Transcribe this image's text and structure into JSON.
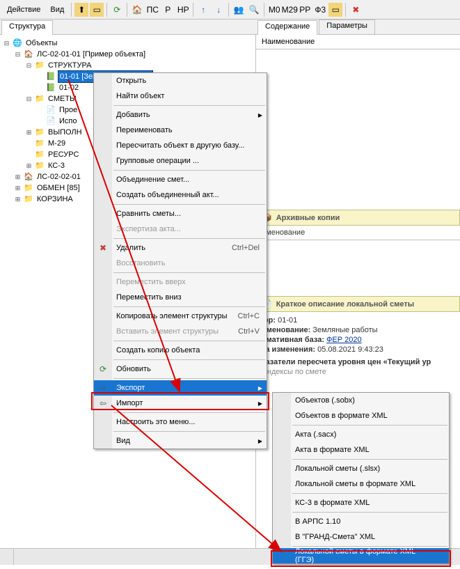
{
  "toolbar": {
    "action": "Действие",
    "view": "Вид"
  },
  "left_tab": "Структура",
  "right_tabs": {
    "content": "Содержание",
    "params": "Параметры"
  },
  "right_header": "Наименование",
  "tree": {
    "root": "Объекты",
    "items": [
      {
        "indent": 2,
        "exp": "⊟",
        "icon": "🏠",
        "cls": "house",
        "label": "ЛС-02-01-01 [Пример объекта]"
      },
      {
        "indent": 3,
        "exp": "⊟",
        "icon": "📁",
        "cls": "folder",
        "label": "СТРУКТУРА"
      },
      {
        "indent": 4,
        "exp": "",
        "icon": "📗",
        "cls": "folder",
        "label": "01-01 [Земляные работы]",
        "selected": true
      },
      {
        "indent": 4,
        "exp": "",
        "icon": "📗",
        "cls": "folder",
        "label": "01-02"
      },
      {
        "indent": 3,
        "exp": "⊟",
        "icon": "📁",
        "cls": "folder",
        "label": "СМЕТЫ"
      },
      {
        "indent": 4,
        "exp": "",
        "icon": "📄",
        "cls": "",
        "label": "Прое"
      },
      {
        "indent": 4,
        "exp": "",
        "icon": "📄",
        "cls": "",
        "label": "Испо"
      },
      {
        "indent": 3,
        "exp": "⊞",
        "icon": "📁",
        "cls": "folder",
        "label": "ВЫПОЛН"
      },
      {
        "indent": 3,
        "exp": "",
        "icon": "📁",
        "cls": "folder",
        "label": "М-29"
      },
      {
        "indent": 3,
        "exp": "",
        "icon": "📁",
        "cls": "folder",
        "label": "РЕСУРС"
      },
      {
        "indent": 3,
        "exp": "⊞",
        "icon": "📁",
        "cls": "folder",
        "label": "КС-3"
      },
      {
        "indent": 2,
        "exp": "⊞",
        "icon": "🏠",
        "cls": "house",
        "label": "ЛС-02-02-01"
      },
      {
        "indent": 2,
        "exp": "⊞",
        "icon": "📁",
        "cls": "folder-y",
        "label": "ОБМЕН  [85]"
      },
      {
        "indent": 2,
        "exp": "⊞",
        "icon": "📁",
        "cls": "folder-y",
        "label": "КОРЗИНА"
      }
    ]
  },
  "ctx": {
    "items": [
      {
        "label": "Открыть"
      },
      {
        "label": "Найти объект"
      },
      {
        "sep": true
      },
      {
        "label": "Добавить",
        "arrow": true
      },
      {
        "label": "Переименовать"
      },
      {
        "label": "Пересчитать объект в другую базу..."
      },
      {
        "label": "Групповые операции ..."
      },
      {
        "sep": true
      },
      {
        "label": "Объединение смет..."
      },
      {
        "label": "Создать объединенный акт..."
      },
      {
        "sep": true
      },
      {
        "label": "Сравнить сметы..."
      },
      {
        "label": "Экспертиза акта...",
        "disabled": true
      },
      {
        "sep": true
      },
      {
        "label": "Удалить",
        "shortcut": "Ctrl+Del",
        "icon": "✖",
        "iconcolor": "#c04040"
      },
      {
        "label": "Восстановить",
        "disabled": true
      },
      {
        "sep": true
      },
      {
        "label": "Переместить вверх",
        "disabled": true
      },
      {
        "label": "Переместить вниз"
      },
      {
        "sep": true
      },
      {
        "label": "Копировать элемент структуры",
        "shortcut": "Ctrl+C"
      },
      {
        "label": "Вставить элемент структуры",
        "shortcut": "Ctrl+V",
        "disabled": true
      },
      {
        "sep": true
      },
      {
        "label": "Создать копию объекта"
      },
      {
        "sep": true
      },
      {
        "label": "Обновить",
        "icon": "⟳",
        "iconcolor": "#2a8a2a"
      },
      {
        "sep": true
      },
      {
        "label": "Экспорт",
        "arrow": true,
        "selected": true,
        "icon": "⇨"
      },
      {
        "label": "Импорт",
        "arrow": true,
        "icon": "⇦"
      },
      {
        "sep": true
      },
      {
        "label": "Настроить это меню..."
      },
      {
        "sep": true
      },
      {
        "label": "Вид",
        "arrow": true
      }
    ]
  },
  "submenu": {
    "items": [
      {
        "label": "Объектов (.sobx)"
      },
      {
        "label": "Объектов в формате XML"
      },
      {
        "sep": true
      },
      {
        "label": "Акта (.sacx)"
      },
      {
        "label": "Акта в формате XML"
      },
      {
        "sep": true
      },
      {
        "label": "Локальной сметы (.slsx)"
      },
      {
        "label": "Локальной сметы в формате XML"
      },
      {
        "sep": true
      },
      {
        "label": "КС-3 в формате XML"
      },
      {
        "sep": true
      },
      {
        "label": "В АРПС 1.10"
      },
      {
        "label": "В \"ГРАНД-Смета\" XML"
      },
      {
        "sep": true
      },
      {
        "label": "Локальной сметы в формате XML (ГГЭ)",
        "selected": true
      }
    ]
  },
  "right": {
    "archive": "Архивные копии",
    "naimen": "именование",
    "brief": "Краткое описание локальной сметы",
    "shifr_label": "фр:",
    "shifr_val": "01-01",
    "naim_label": "именование:",
    "naim_val": "Земляные работы",
    "base_label": "рмативная база:",
    "base_val": "ФЕР 2020",
    "date_label": "та изменения:",
    "date_val": "05.08.2021 9:43:23",
    "recalc": "казатели пересчета уровня цен  «Текущий ур",
    "indexes": "Индексы по смете"
  }
}
